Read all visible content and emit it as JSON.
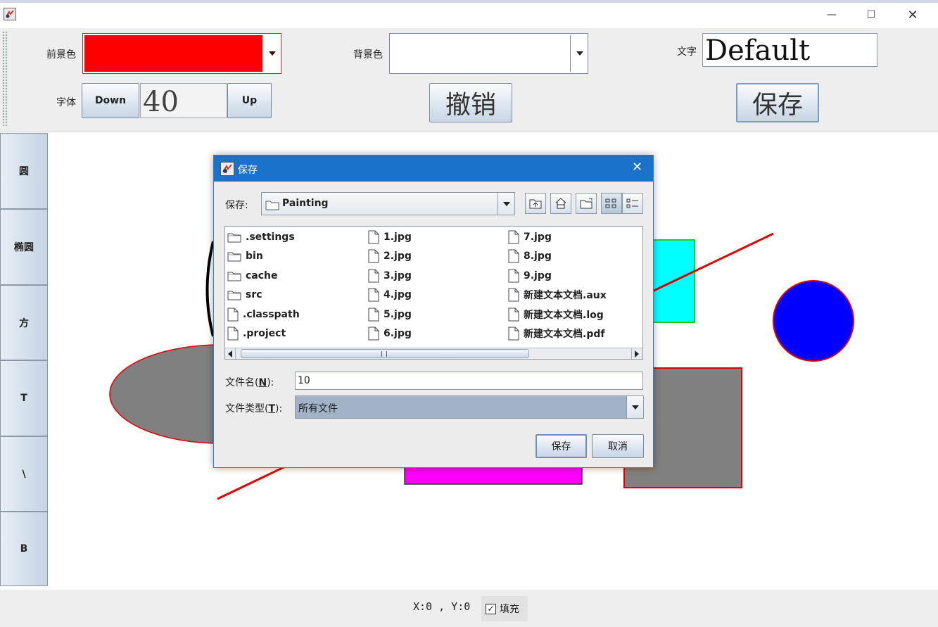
{
  "window": {
    "minimize_glyph": "—",
    "maximize_glyph": "☐",
    "close_glyph": "✕"
  },
  "toolbar": {
    "foreground_label": "前景色",
    "foreground_color": "#ff0000",
    "background_label": "背景色",
    "background_color": "#ffffff",
    "text_label": "文字",
    "text_value": "Default",
    "font_label": "字体",
    "font_down_label": "Down",
    "font_size_value": "40",
    "font_up_label": "Up",
    "undo_label": "撤销",
    "save_label": "保存"
  },
  "side_tools": [
    {
      "label": "圆",
      "icon": "circle-tool"
    },
    {
      "label": "椭圆",
      "icon": "ellipse-tool"
    },
    {
      "label": "方",
      "icon": "rectangle-tool"
    },
    {
      "label": "T",
      "icon": "text-tool"
    },
    {
      "label": "\\",
      "icon": "line-tool"
    },
    {
      "label": "B",
      "icon": "brush-tool"
    }
  ],
  "canvas": {
    "shape_colors": {
      "black_arc": "#000000",
      "gray_ellipse": "#808080",
      "cyan_rect": "#00ffff",
      "red_line": "#dd0000",
      "blue_circle": "#0000ff",
      "magenta_rect": "#ff00ff",
      "gray_rect": "#808080"
    }
  },
  "status": {
    "coords": "X:0 , Y:0",
    "fill_label": "填充",
    "fill_checked": true
  },
  "dialog": {
    "title": "保存",
    "close_glyph": "✕",
    "save_in_label": "保存:",
    "save_in_value": "Painting",
    "files": [
      {
        "name": ".settings",
        "type": "folder"
      },
      {
        "name": "bin",
        "type": "folder"
      },
      {
        "name": "cache",
        "type": "folder"
      },
      {
        "name": "src",
        "type": "folder"
      },
      {
        "name": ".classpath",
        "type": "file"
      },
      {
        "name": ".project",
        "type": "file"
      },
      {
        "name": "1.jpg",
        "type": "file"
      },
      {
        "name": "2.jpg",
        "type": "file"
      },
      {
        "name": "3.jpg",
        "type": "file"
      },
      {
        "name": "4.jpg",
        "type": "file"
      },
      {
        "name": "5.jpg",
        "type": "file"
      },
      {
        "name": "6.jpg",
        "type": "file"
      },
      {
        "name": "7.jpg",
        "type": "file"
      },
      {
        "name": "8.jpg",
        "type": "file"
      },
      {
        "name": "9.jpg",
        "type": "file"
      },
      {
        "name": "新建文本文档.aux",
        "type": "file"
      },
      {
        "name": "新建文本文档.log",
        "type": "file"
      },
      {
        "name": "新建文本文档.pdf",
        "type": "file"
      }
    ],
    "file_name_label": "文件名(",
    "file_name_mnemonic": "N",
    "file_name_label_end": "):",
    "file_name_value": "10",
    "file_type_label": "文件类型(",
    "file_type_mnemonic": "T",
    "file_type_label_end": "):",
    "file_type_value": "所有文件",
    "save_button": "保存",
    "cancel_button": "取消"
  }
}
